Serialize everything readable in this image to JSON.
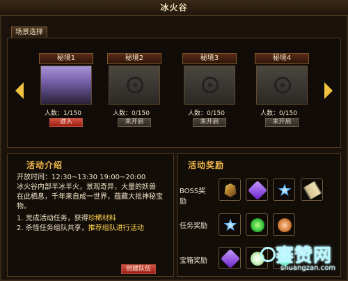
{
  "window": {
    "title": "冰火谷"
  },
  "scene_select": {
    "tab_label": "场景选择"
  },
  "realms": [
    {
      "title": "秘境1",
      "count": "人数：1/150",
      "button": "进入"
    },
    {
      "title": "秘境2",
      "count": "人数：0/150",
      "button": "未开启"
    },
    {
      "title": "秘境3",
      "count": "人数：0/150",
      "button": "未开启"
    },
    {
      "title": "秘境4",
      "count": "人数：0/150",
      "button": "未开启"
    }
  ],
  "intro": {
    "title": "活动介绍",
    "time": "开放时间：12:30~13:30 19:00~20:00",
    "desc_lines": [
      "冰火谷内部半冰半火，景观奇异，大量的妖兽",
      "在此栖息，千年来自成一世界，蕴藏大批神秘宝",
      "物。"
    ],
    "item1_prefix": "1. 完成活动任务，获得",
    "item1_highlight": "珍稀材料",
    "item2_prefix": "2. 杀怪任务组队共享，",
    "item2_highlight": "推荐组队进行活动",
    "create_team_button": "创建队伍"
  },
  "rewards": {
    "title": "活动奖励",
    "rows": [
      {
        "label": "BOSS奖励"
      },
      {
        "label": "任务奖励"
      },
      {
        "label": "宝箱奖励"
      }
    ]
  },
  "watermark": {
    "big": "赛赞网",
    "small": "shuangzan.com"
  }
}
